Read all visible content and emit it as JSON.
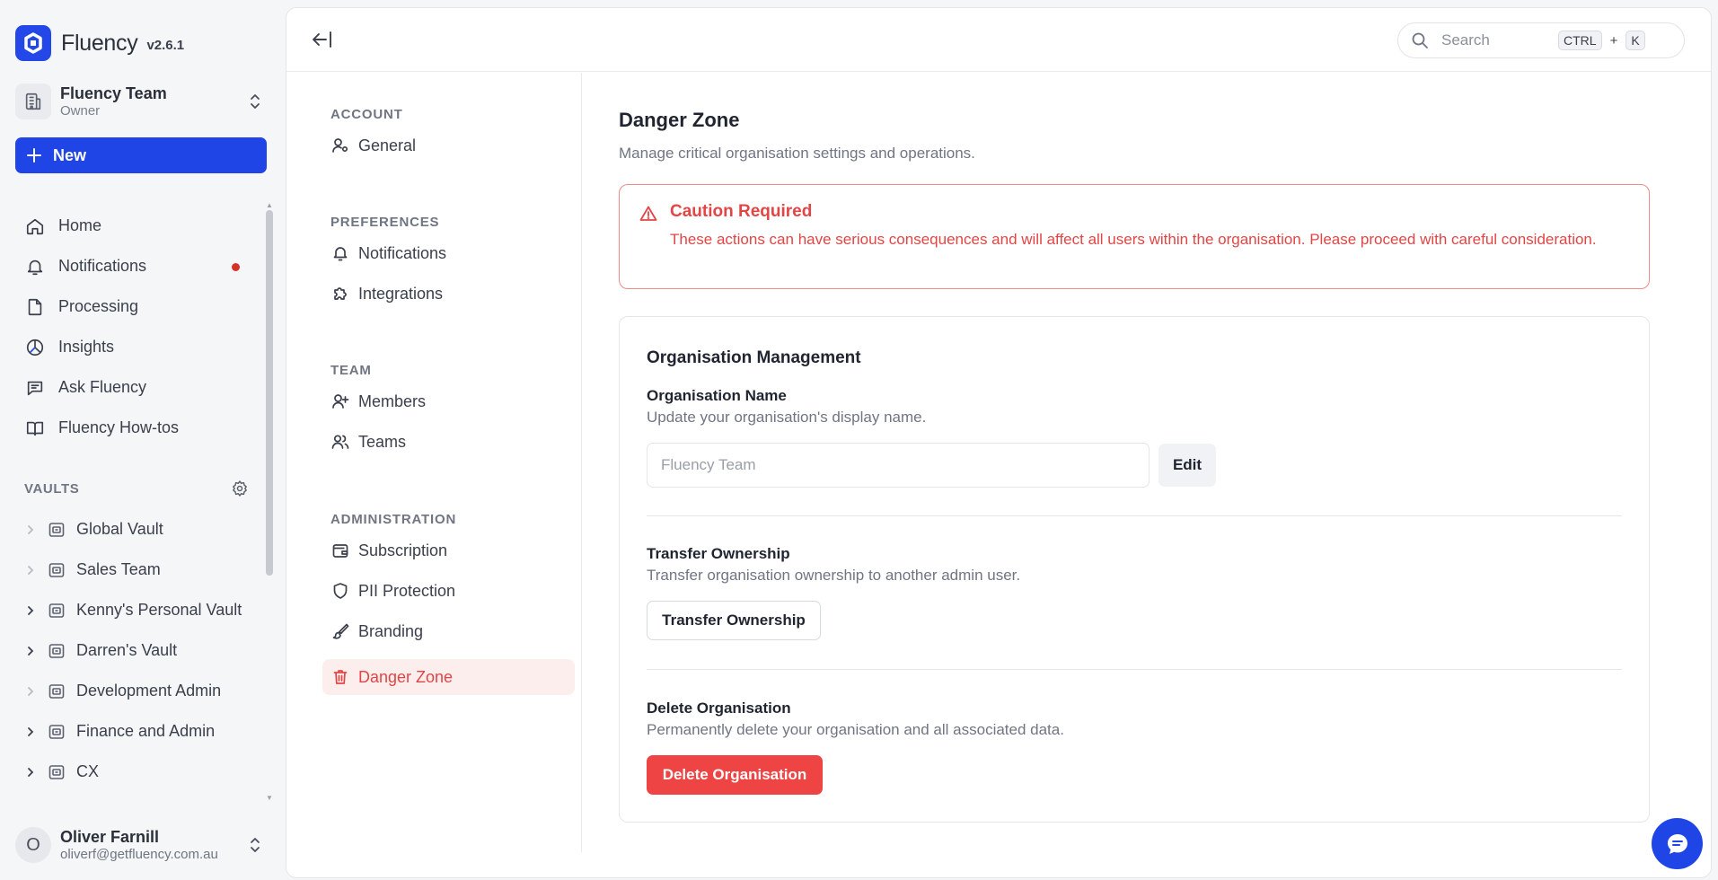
{
  "brand": {
    "name": "Fluency",
    "version": "v2.6.1"
  },
  "team": {
    "name": "Fluency Team",
    "role": "Owner"
  },
  "new_button": {
    "label": "New"
  },
  "nav": [
    {
      "label": "Home",
      "icon": "home-icon"
    },
    {
      "label": "Notifications",
      "icon": "bell-icon",
      "unread": true
    },
    {
      "label": "Processing",
      "icon": "file-icon"
    },
    {
      "label": "Insights",
      "icon": "pie-chart-icon"
    },
    {
      "label": "Ask Fluency",
      "icon": "chat-icon"
    },
    {
      "label": "Fluency How-tos",
      "icon": "book-icon"
    }
  ],
  "vaults": {
    "heading": "VAULTS",
    "items": [
      {
        "label": "Global Vault",
        "expandable": false
      },
      {
        "label": "Sales Team",
        "expandable": false
      },
      {
        "label": "Kenny's Personal Vault",
        "expandable": true
      },
      {
        "label": "Darren's Vault",
        "expandable": true
      },
      {
        "label": "Development Admin",
        "expandable": false
      },
      {
        "label": "Finance and Admin",
        "expandable": true
      },
      {
        "label": "CX",
        "expandable": true
      }
    ]
  },
  "user": {
    "initial": "O",
    "name": "Oliver Farnill",
    "email": "oliverf@getfluency.com.au"
  },
  "topbar": {
    "search_placeholder": "Search",
    "shortcut_key1": "CTRL",
    "shortcut_plus": "+",
    "shortcut_key2": "K"
  },
  "settings_nav": {
    "sections": [
      {
        "title": "ACCOUNT",
        "items": [
          {
            "label": "General",
            "icon": "user-gear-icon"
          }
        ]
      },
      {
        "title": "PREFERENCES",
        "items": [
          {
            "label": "Notifications",
            "icon": "bell-icon"
          },
          {
            "label": "Integrations",
            "icon": "puzzle-icon"
          }
        ]
      },
      {
        "title": "TEAM",
        "items": [
          {
            "label": "Members",
            "icon": "user-plus-icon"
          },
          {
            "label": "Teams",
            "icon": "users-icon"
          }
        ]
      },
      {
        "title": "ADMINISTRATION",
        "items": [
          {
            "label": "Subscription",
            "icon": "wallet-icon"
          },
          {
            "label": "PII Protection",
            "icon": "shield-icon"
          },
          {
            "label": "Branding",
            "icon": "brush-icon"
          },
          {
            "label": "Danger Zone",
            "icon": "trash-icon",
            "active": true
          }
        ]
      }
    ]
  },
  "page": {
    "title": "Danger Zone",
    "subtitle": "Manage critical organisation settings and operations."
  },
  "alert": {
    "title": "Caution Required",
    "body": "These actions can have serious consequences and will affect all users within the organisation. Please proceed with careful consideration."
  },
  "org": {
    "title": "Organisation Management",
    "name_label": "Organisation Name",
    "name_desc": "Update your organisation's display name.",
    "name_placeholder": "Fluency Team",
    "edit_label": "Edit",
    "transfer_label": "Transfer Ownership",
    "transfer_desc": "Transfer organisation ownership to another admin user.",
    "transfer_button": "Transfer Ownership",
    "delete_label": "Delete Organisation",
    "delete_desc": "Permanently delete your organisation and all associated data.",
    "delete_button": "Delete Organisation"
  },
  "colors": {
    "primary": "#1f45e6",
    "danger": "#ef4444",
    "danger_text": "#e24545",
    "danger_bg": "#fdeeee",
    "notification_dot": "#d6322a"
  }
}
